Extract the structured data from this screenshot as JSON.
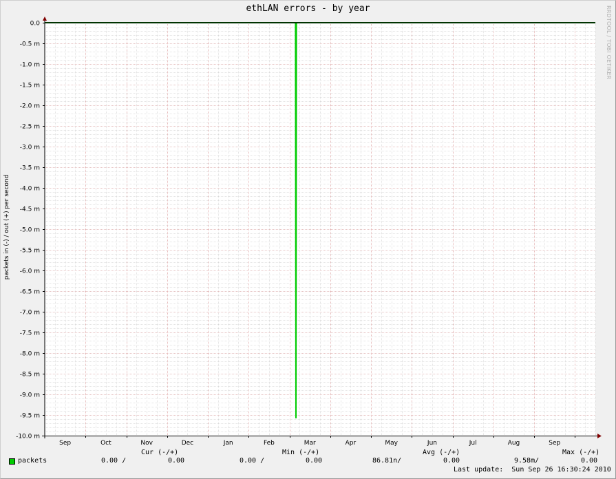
{
  "watermark": "RRDTOOL / TOBI OETIKER",
  "legend": {
    "headers": {
      "cur": "Cur (-/+)",
      "min": "Min (-/+)",
      "avg": "Avg (-/+)",
      "max": "Max (-/+)"
    },
    "series_label": "packets",
    "cur_in": "0.00 /",
    "cur_out": "0.00",
    "min_in": "0.00 /",
    "min_out": "0.00",
    "avg_in": "86.81n/",
    "avg_out": "0.00",
    "max_in": "9.58m/",
    "max_out": "0.00",
    "last_update": "Last update:  Sun Sep 26 16:30:24 2010"
  },
  "colors": {
    "series": "#00cc00",
    "background": "#f0f0f0",
    "plot_bg": "#ffffff",
    "grid_major": "#e8a0a0",
    "grid_minor": "#c8c8c8",
    "axis": "#000000",
    "arrow": "#800000"
  },
  "chart_data": {
    "type": "line",
    "title": "ethLAN errors - by year",
    "ylabel": "packets in (-) / out (+) per second",
    "xlabel": "",
    "ylim": [
      -10.0,
      0.0
    ],
    "yticks": [
      "0.0",
      "-0.5 m",
      "-1.0 m",
      "-1.5 m",
      "-2.0 m",
      "-2.5 m",
      "-3.0 m",
      "-3.5 m",
      "-4.0 m",
      "-4.5 m",
      "-5.0 m",
      "-5.5 m",
      "-6.0 m",
      "-6.5 m",
      "-7.0 m",
      "-7.5 m",
      "-8.0 m",
      "-8.5 m",
      "-9.0 m",
      "-9.5 m",
      "-10.0 m"
    ],
    "ytick_values": [
      0,
      -0.5,
      -1.0,
      -1.5,
      -2.0,
      -2.5,
      -3.0,
      -3.5,
      -4.0,
      -4.5,
      -5.0,
      -5.5,
      -6.0,
      -6.5,
      -7.0,
      -7.5,
      -8.0,
      -8.5,
      -9.0,
      -9.5,
      -10.0
    ],
    "x_unit": "months",
    "xlim": [
      0,
      13.5
    ],
    "xticks": [
      "Sep",
      "Oct",
      "Nov",
      "Dec",
      "Jan",
      "Feb",
      "Mar",
      "Apr",
      "May",
      "Jun",
      "Jul",
      "Aug",
      "Sep"
    ],
    "xtick_values": [
      0.5,
      1.5,
      2.5,
      3.5,
      4.5,
      5.5,
      6.5,
      7.5,
      8.5,
      9.5,
      10.5,
      11.5,
      12.5
    ],
    "month_boundaries": [
      1,
      2,
      3,
      4,
      5,
      6,
      7,
      8,
      9,
      10,
      11,
      12,
      13
    ],
    "series": [
      {
        "name": "packets",
        "direction": "in",
        "points": [
          [
            0,
            0
          ],
          [
            6.15,
            0
          ],
          [
            6.16,
            -9.58
          ],
          [
            6.17,
            0
          ],
          [
            13.5,
            0
          ]
        ]
      }
    ],
    "grid": true,
    "legend_position": "bottom"
  }
}
